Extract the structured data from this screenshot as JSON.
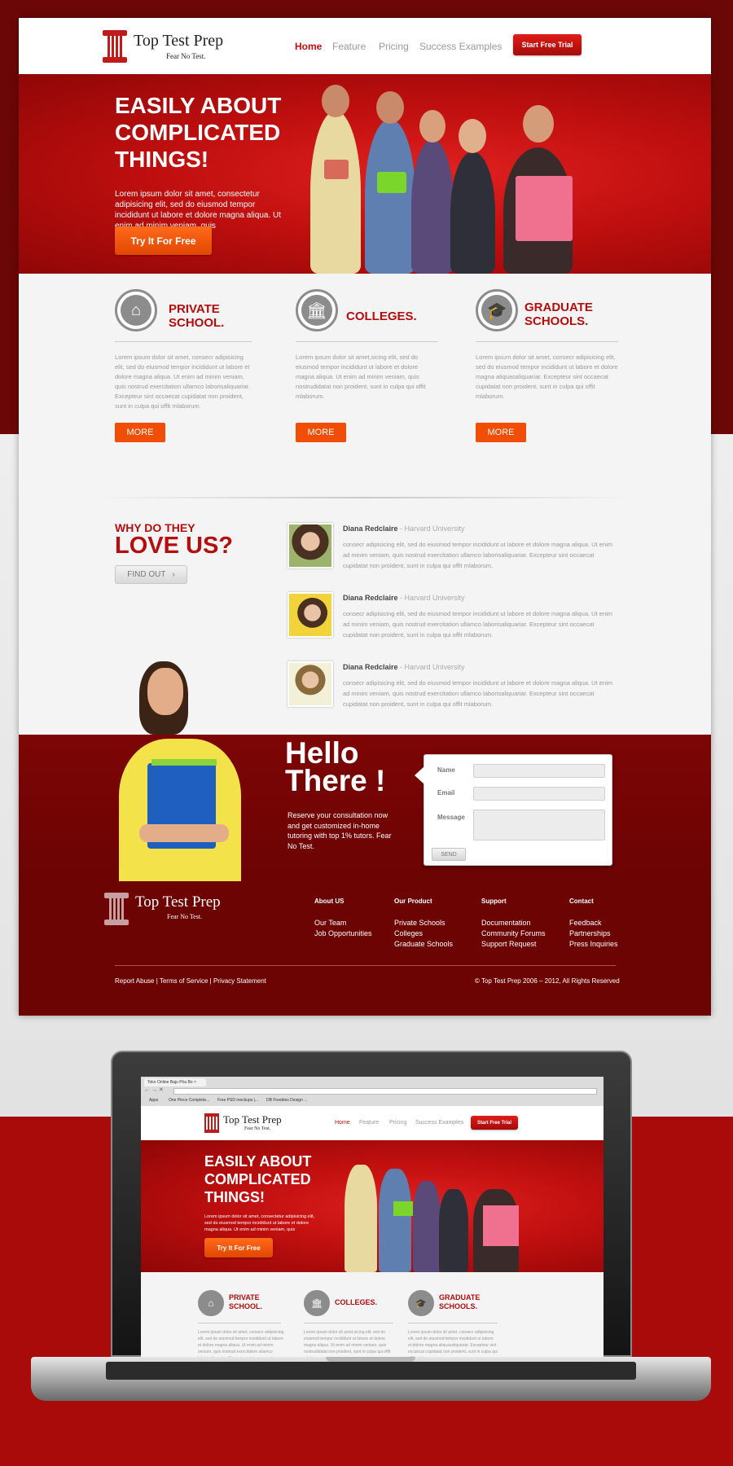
{
  "brand": {
    "name": "Top Test Prep",
    "tagline": "Fear No Test."
  },
  "nav": {
    "links": [
      "Home",
      "Feature",
      "Pricing",
      "Success Examples"
    ],
    "cta": "Start Free Trial",
    "active_color": "#c40d0d"
  },
  "hero": {
    "line1": "EASILY ABOUT",
    "line2": "COMPLICATED",
    "line3": "THINGS!",
    "text": "Lorem ipsum dolor sit amet, consectetur adipisicing elit, sed do eiusmod tempor incididunt ut labore et dolore magna aliqua. Ut enim ad minim veniam, quis",
    "button": "Try It For Free"
  },
  "features": [
    {
      "icon": "house-icon",
      "title_1": "PRIVATE",
      "title_2": "SCHOOL.",
      "text": "Lorem ipsum dolor sit amet, consecr adipisicing elit, sed do eiusmod tempor incididunt ut labore et dolore magna aliqua. Ut enim ad minim veniam, quis nostrud exercitation ullamco laborisaliquariar. Excepteur sint occaecat cupidatat non proident, sunt in culpa qui offit mlaborum.",
      "button": "MORE"
    },
    {
      "icon": "bank-icon",
      "title_1": "COLLEGES.",
      "title_2": "",
      "text": "Lorem ipsum dolor sit amet,sicing elit, sed do eiusmod tempor incididunt ut labore et dolore magna aliqua. Ut enim ad minim veniam, quis nostrudidatat non proident, sunt in culpa qui offit mlaborum.",
      "button": "MORE"
    },
    {
      "icon": "graduation-cap-icon",
      "title_1": "GRADUATE",
      "title_2": "SCHOOLS.",
      "text": "Lorem ipsum dolor sit amet, consecr adipisicing elit, sed do eiusmod tempor incididunt ut labore et dolore magna aliquasaliquariar. Excepteur sint occaecat cupidatat non proident, sunt in culpa qui offit mlaborum.",
      "button": "MORE"
    }
  ],
  "testimonials_section": {
    "kicker": "WHY DO THEY",
    "headline": "LOVE US?",
    "button": "FIND OUT",
    "items": [
      {
        "name": "Diana Redclaire",
        "school": " - Harvard University",
        "text": "consecr adipisicing elit, sed do eiusmod tempor incididunt ut labore et dolore magna aliqua. Ut enim ad minim veniam, quis nostrud exercitation ullamco laborisaliquariar. Excepteur sint occaecat cupidatat non proident, sunt in culpa qui offit mlaborum."
      },
      {
        "name": "Diana Redclaire",
        "school": " - Harvard University",
        "text": "consecr adipisicing elit, sed do eiusmod tempor incididunt ut labore et dolore magna aliqua. Ut enim ad minim veniam, quis nostrud exercitation ullamco laborisaliquariar. Excepteur sint occaecat cupidatat non proident, sunt in culpa qui offit mlaborum."
      },
      {
        "name": "Diana Redclaire",
        "school": " - Harvard University",
        "text": "consecr adipisicing elit, sed do eiusmod tempor incididunt ut labore et dolore magna aliqua. Ut enim ad minim veniam, quis nostrud exercitation ullamco laborisaliquariar. Excepteur sint occaecat cupidatat non proident, sunt in culpa qui offit mlaborum."
      }
    ]
  },
  "contact": {
    "hello_1": "Hello",
    "hello_2": "There !",
    "text": "Reserve your consultation now and get customized in-home tutoring with top 1% tutors. Fear No Test.",
    "form": {
      "name_label": "Name",
      "email_label": "Email",
      "message_label": "Message",
      "button": "SEND"
    }
  },
  "footer": {
    "columns": [
      {
        "heading": "About US",
        "links": [
          "Our Team",
          "Job Opportunities"
        ]
      },
      {
        "heading": "Our Product",
        "links": [
          "Private Schools",
          "Colleges",
          "Graduate Schools"
        ]
      },
      {
        "heading": "Support",
        "links": [
          "Documentation",
          "Community Forums",
          "Support Request"
        ]
      },
      {
        "heading": "Contact",
        "links": [
          "Feedback",
          "Partnerships",
          "Press Inquiries"
        ]
      }
    ],
    "legal": "Report Abuse | Terms of Service | Privacy Statement",
    "copyright": "© Top Test Prep 2006 – 2012, All Rights Reserved"
  },
  "browser": {
    "tab_title": "Toko Online Baju Pria Bo",
    "bookmarks": [
      "Apps",
      "One Piece Complete...",
      "Free PSD mockups |...",
      "DB Freebies Design ..."
    ]
  },
  "colors": {
    "brand_red": "#c40d0d",
    "dark_red": "#6c0404",
    "orange": "#f24d05"
  }
}
